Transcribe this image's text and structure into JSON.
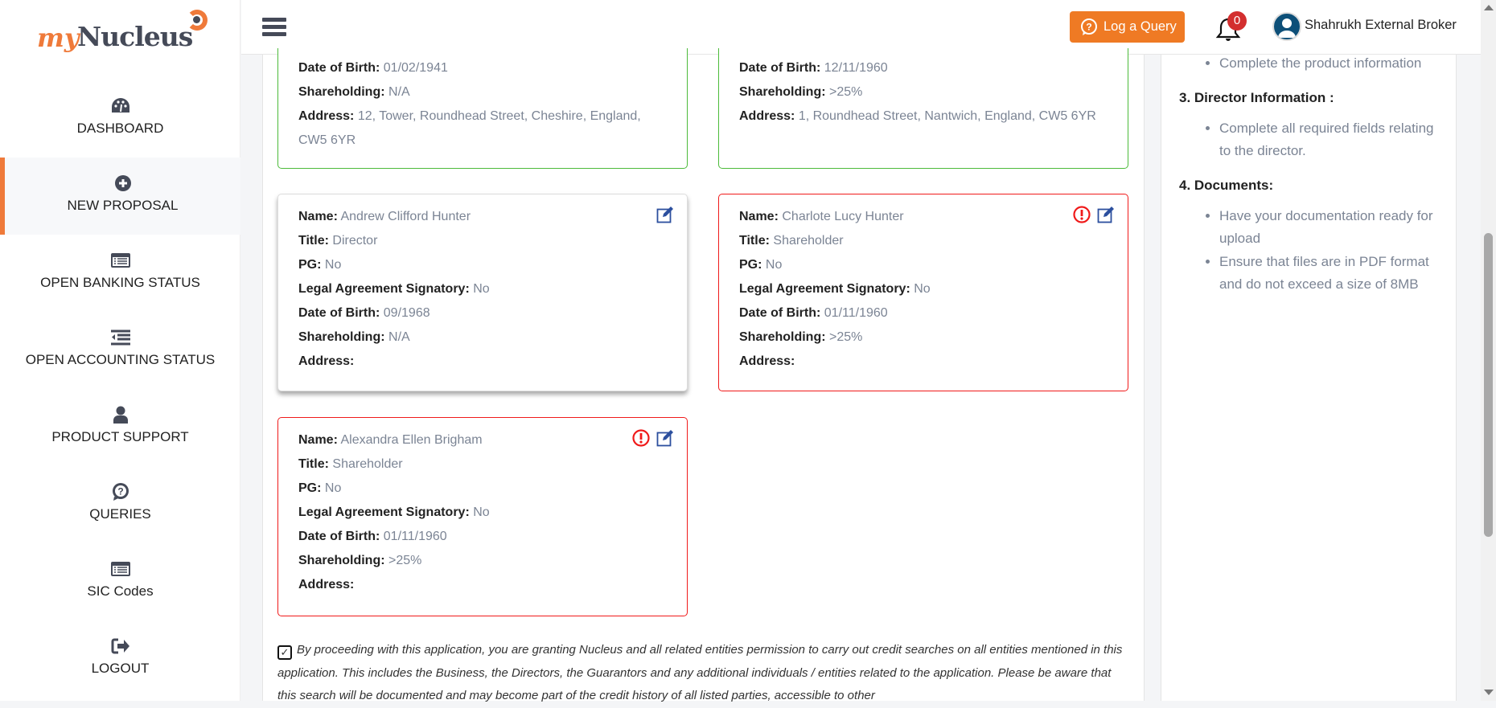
{
  "brand": {
    "logo_text_my": "my",
    "logo_text_nucleus": "Nucleus"
  },
  "sidebar": {
    "items": [
      {
        "label": "DASHBOARD",
        "icon": "dashboard-icon"
      },
      {
        "label": "NEW PROPOSAL",
        "icon": "plus-circle-icon",
        "active": true
      },
      {
        "label": "OPEN BANKING STATUS",
        "icon": "list-card-icon"
      },
      {
        "label": "OPEN ACCOUNTING STATUS",
        "icon": "indent-list-icon"
      },
      {
        "label": "PRODUCT SUPPORT",
        "icon": "user-icon"
      },
      {
        "label": "QUERIES",
        "icon": "question-bubble-icon"
      },
      {
        "label": "SIC Codes",
        "icon": "list-card-icon"
      },
      {
        "label": "LOGOUT",
        "icon": "logout-icon"
      }
    ]
  },
  "topbar": {
    "log_query": "Log a Query",
    "notification_count": "0",
    "user_name": "Shahrukh External Broker"
  },
  "labels": {
    "name": "Name:",
    "title": "Title:",
    "pg": "PG:",
    "las": "Legal Agreement Signatory:",
    "dob": "Date of Birth:",
    "shareholding": "Shareholding:",
    "address": "Address:"
  },
  "cards": [
    {
      "dob": "01/02/1941",
      "shareholding": "N/A",
      "address": "12, Tower, Roundhead Street, Cheshire, England, CW5 6YR",
      "status": "valid"
    },
    {
      "dob": "12/11/1960",
      "shareholding": ">25%",
      "address": "1, Roundhead Street, Nantwich, England, CW5 6YR",
      "status": "valid"
    },
    {
      "name": "Andrew Clifford Hunter",
      "title": "Director",
      "pg": "No",
      "las": "No",
      "dob": "09/1968",
      "shareholding": "N/A",
      "address": "",
      "status": "selected"
    },
    {
      "name": "Charlote Lucy Hunter",
      "title": "Shareholder",
      "pg": "No",
      "las": "No",
      "dob": "01/11/1960",
      "shareholding": ">25%",
      "address": "",
      "status": "error"
    },
    {
      "name": "Alexandra Ellen Brigham",
      "title": "Shareholder",
      "pg": "No",
      "las": "No",
      "dob": "01/11/1960",
      "shareholding": ">25%",
      "address": "",
      "status": "error"
    }
  ],
  "consent": {
    "checked": true,
    "text": "By proceeding with this application, you are granting Nucleus and all related entities permission to carry out credit searches on all entities mentioned in this application. This includes the Business, the Directors, the Guarantors and any additional individuals / entities related to the application. Please be aware that this search will be documented and may become part of the credit history of all listed parties, accessible to other"
  },
  "guide": {
    "s2_bullets": [
      "Complete the product information"
    ],
    "s3_title": "3. Director Information :",
    "s3_bullets": [
      "Complete all required fields relating to the director."
    ],
    "s4_title": "4. Documents:",
    "s4_bullets": [
      "Have your documentation ready for upload",
      "Ensure that files are in PDF format and do not exceed a size of 8MB"
    ]
  },
  "colors": {
    "accent": "#ef7a24",
    "valid": "#4cbb3a",
    "error": "#f01a1a",
    "edit": "#2c4f9e"
  }
}
